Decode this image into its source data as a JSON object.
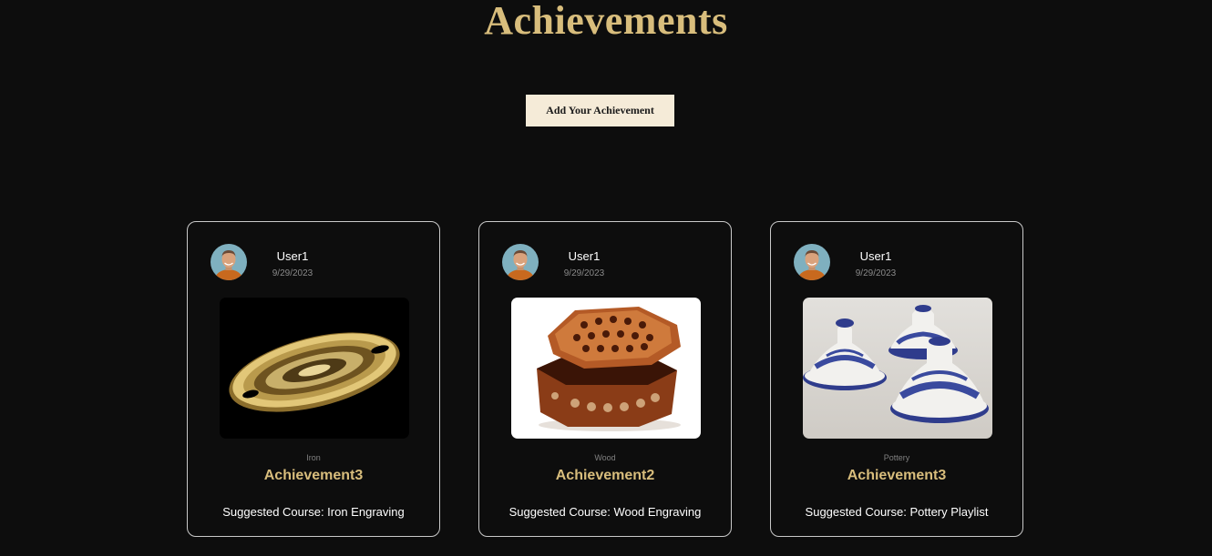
{
  "page": {
    "title": "Achievements",
    "add_button_label": "Add Your Achievement"
  },
  "colors": {
    "background": "#0d0d0d",
    "accent_gold": "#d8bd7c",
    "button_bg": "#f5ebd8",
    "card_border": "#c9c9c9"
  },
  "cards": [
    {
      "user": "User1",
      "date": "9/29/2023",
      "image": "brass-tray-image",
      "category": "Iron",
      "title": "Achievement3",
      "suggested": "Suggested Course: Iron Engraving"
    },
    {
      "user": "User1",
      "date": "9/29/2023",
      "image": "wooden-box-image",
      "category": "Wood",
      "title": "Achievement2",
      "suggested": "Suggested Course: Wood Engraving"
    },
    {
      "user": "User1",
      "date": "9/29/2023",
      "image": "pottery-tagines-image",
      "category": "Pottery",
      "title": "Achievement3",
      "suggested": "Suggested Course: Pottery Playlist"
    }
  ]
}
